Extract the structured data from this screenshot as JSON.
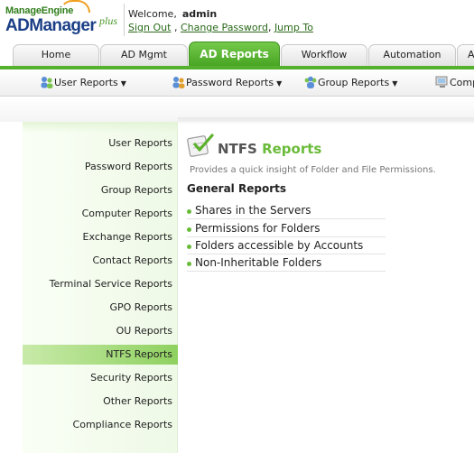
{
  "brand": {
    "company": "ManageEngine",
    "product": "ADManager",
    "edition": "plus"
  },
  "header": {
    "welcome_label": "Welcome,",
    "username": "admin",
    "links": {
      "sign_out": "Sign Out",
      "sep1": ",",
      "change_password": "Change Password",
      "sep2": ",",
      "jump_to": "Jump To"
    }
  },
  "tabs": [
    {
      "label": "Home",
      "active": false
    },
    {
      "label": "AD Mgmt",
      "active": false
    },
    {
      "label": "AD Reports",
      "active": true
    },
    {
      "label": "Workflow",
      "active": false
    },
    {
      "label": "Automation",
      "active": false
    },
    {
      "label": "A",
      "active": false
    }
  ],
  "subnav": [
    {
      "label": "User Reports",
      "icon": "users-icon"
    },
    {
      "label": "Password Reports",
      "icon": "password-users-icon"
    },
    {
      "label": "Group Reports",
      "icon": "group-icon"
    },
    {
      "label": "Comp",
      "icon": "computer-icon"
    }
  ],
  "left_menu": [
    {
      "label": "User Reports",
      "active": false
    },
    {
      "label": "Password Reports",
      "active": false
    },
    {
      "label": "Group Reports",
      "active": false
    },
    {
      "label": "Computer Reports",
      "active": false
    },
    {
      "label": "Exchange Reports",
      "active": false
    },
    {
      "label": "Contact Reports",
      "active": false
    },
    {
      "label": "Terminal Service Reports",
      "active": false
    },
    {
      "label": "GPO Reports",
      "active": false
    },
    {
      "label": "OU Reports",
      "active": false
    },
    {
      "label": "NTFS Reports",
      "active": true
    },
    {
      "label": "Security Reports",
      "active": false
    },
    {
      "label": "Other Reports",
      "active": false
    },
    {
      "label": "Compliance Reports",
      "active": false
    }
  ],
  "content": {
    "title_prefix": "NTFS",
    "title_suffix": "Reports",
    "subtitle": "Provides a quick insight of Folder and File Permissions.",
    "section_heading": "General Reports",
    "reports": [
      "Shares in the Servers",
      "Permissions for Folders",
      "Folders accessible by Accounts",
      "Non-Inheritable Folders"
    ]
  },
  "colors": {
    "accent_green": "#55b02e",
    "brand_blue": "#1b3f86",
    "link_green": "#2a6a1a"
  }
}
